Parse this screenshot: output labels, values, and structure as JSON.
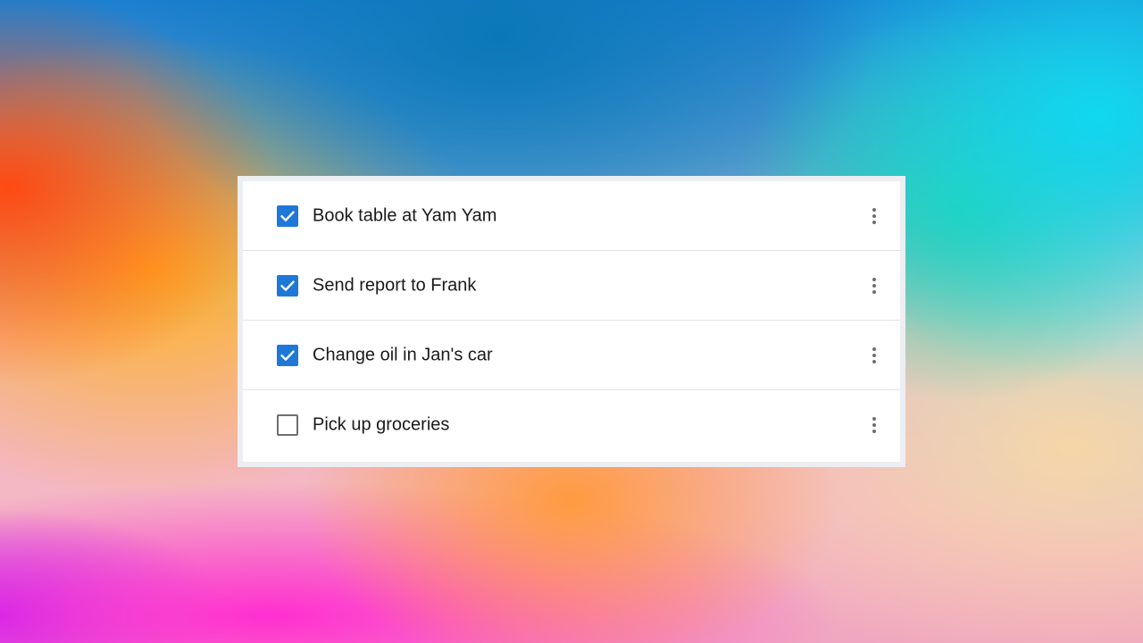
{
  "todos": [
    {
      "label": "Book table at Yam Yam",
      "checked": true
    },
    {
      "label": "Send report to Frank",
      "checked": true
    },
    {
      "label": "Change oil in Jan's car",
      "checked": true
    },
    {
      "label": "Pick up groceries",
      "checked": false
    }
  ],
  "icons": {
    "checkbox_checked": "check-icon",
    "checkbox_unchecked": "empty-checkbox",
    "menu": "more-vertical-icon"
  },
  "colors": {
    "accent": "#1e78d8",
    "card_background": "#ffffff",
    "card_border": "#eceef2",
    "text": "#1a1a1a",
    "icon_gray": "#6e6e6e"
  }
}
